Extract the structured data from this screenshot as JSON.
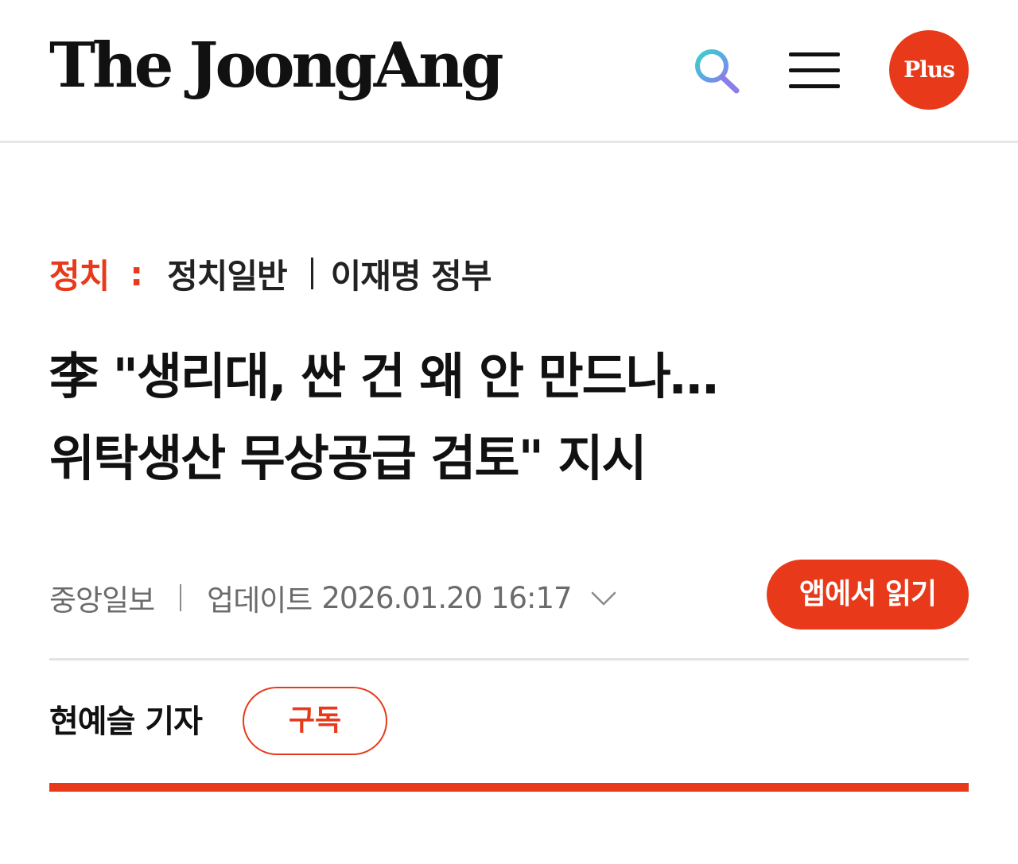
{
  "header": {
    "logo": "The JoongAng",
    "plus_label": "Plus",
    "icons": {
      "search": "search-icon",
      "menu": "hamburger-menu-icon"
    }
  },
  "breadcrumb": {
    "section": "정치",
    "separator": ":",
    "subsection": "정치일반",
    "series": "이재명 정부"
  },
  "article": {
    "headline_lines": [
      "李 \"생리대, 싼 건 왜 안 만드나…",
      "위탁생산 무상공급 검토\" 지시"
    ],
    "source": "중앙일보",
    "updated_label": "업데이트",
    "updated_at": "2026.01.20 16:17",
    "reporter": "현예슬 기자"
  },
  "buttons": {
    "read_in_app": "앱에서 읽기",
    "subscribe": "구독"
  },
  "colors": {
    "accent": "#e83a1a",
    "text": "#111111",
    "muted": "#6b6b6b",
    "divider": "#e3e3e3"
  }
}
